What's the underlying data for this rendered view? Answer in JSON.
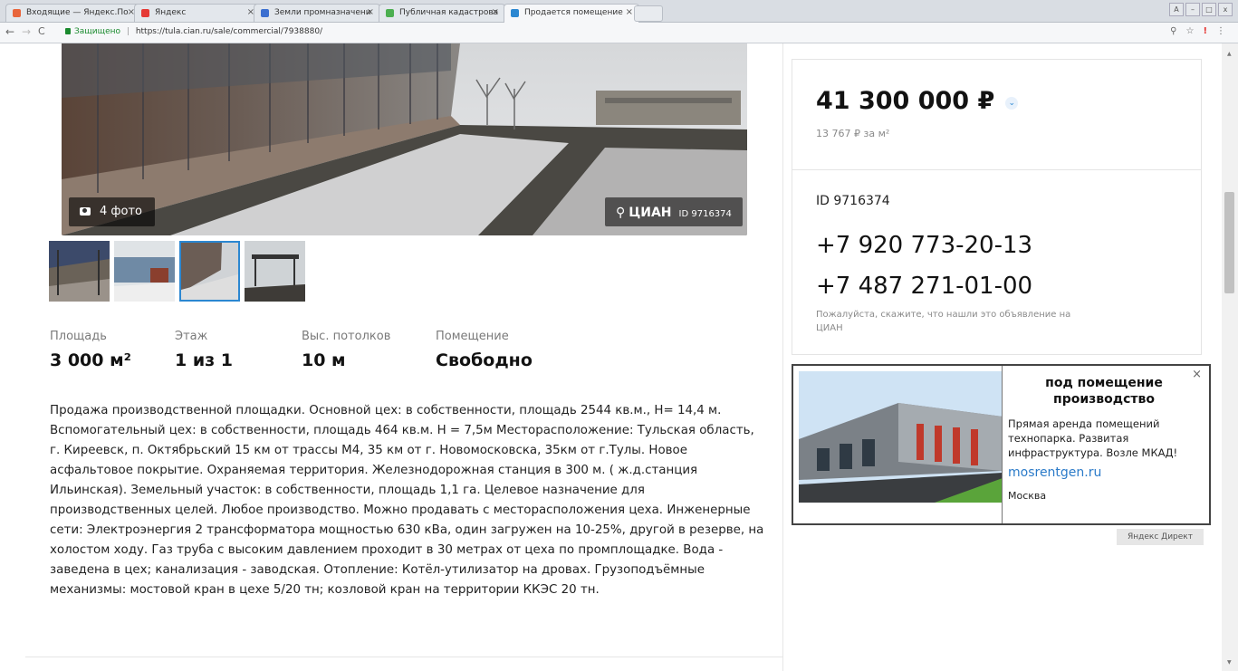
{
  "browser": {
    "tabs": [
      {
        "label": "Входящие — Яндекс.По",
        "color": "#e8653b"
      },
      {
        "label": "Яндекс",
        "color": "#e53935"
      },
      {
        "label": "Земли промназначени",
        "color": "#3b6fd0"
      },
      {
        "label": "Публичная кадастрова",
        "color": "#4caf50"
      },
      {
        "label": "Продается помещение",
        "color": "#2b87d1"
      }
    ],
    "secure_label": "Защищено",
    "url": "https://tula.cian.ru/sale/commercial/7938880/",
    "window_controls": [
      "A",
      "–",
      "□",
      "x"
    ]
  },
  "listing": {
    "photo_count": "4 фото",
    "watermark_logo": "ЦИАН",
    "watermark_id": "ID 9716374",
    "stats": [
      {
        "label": "Площадь",
        "value": "3 000 м²"
      },
      {
        "label": "Этаж",
        "value": "1 из 1"
      },
      {
        "label": "Выс. потолков",
        "value": "10 м"
      },
      {
        "label": "Помещение",
        "value": "Свободно"
      }
    ],
    "description": "Продажа производственной площадки. Основной цех: в собственности, площадь 2544 кв.м., Н= 14,4 м. Вспомогательный цех: в собственности, площадь 464 кв.м. Н = 7,5м Месторасположение: Тульская область, г. Киреевск, п. Октябрьский 15 км от трассы М4, 35 км от г. Новомосковска, 35км от г.Тулы. Новое асфальтовое покрытие. Охраняемая территория. Железнодорожная станция в 300 м. ( ж.д.станция Ильинская). Земельный участок: в собственности, площадь 1,1 га. Целевое назначение для производственных целей. Любое производство. Можно продавать с месторасположения цеха. Инженерные сети: Электроэнергия 2 трансформатора мощностью 630 кВа, один загружен на 10-25%, другой в резерве, на холостом ходу. Газ труба с высоким давлением проходит в 30 метрах от цеха по промплощадке. Вода - заведена в цех; канализация - заводская. Отопление: Котёл-утилизатор на дровах. Грузоподъёмные механизмы: мостовой кран в цехе 5/20 тн; козловой кран на территории ККЭС 20 тн."
  },
  "sidebar": {
    "price": "41 300 000 ₽",
    "price_per_m": "13 767 ₽ за м²",
    "id": "ID 9716374",
    "phones": [
      "+7 920 773-20-13",
      "+7 487 271-01-00"
    ],
    "hint": "Пожалуйста, скажите, что нашли это объявление на ЦИАН"
  },
  "ad": {
    "title": "под помещение производство",
    "text": "Прямая аренда помещений технопарка. Развитая инфраструктура. Возле МКАД!",
    "link": "mosrentgen.ru",
    "city": "Москва",
    "provider": "Яндекс Директ"
  }
}
